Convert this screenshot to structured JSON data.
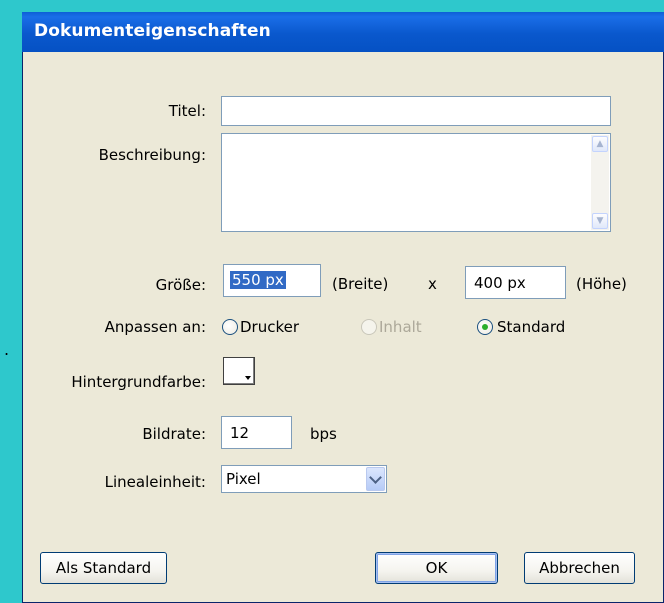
{
  "background_color": "#2ec8cc",
  "stray_text": ".",
  "dialog": {
    "title": "Dokumenteigenschaften",
    "titlebar_color": "#0a58cd",
    "titel": {
      "label": "Titel:",
      "value": ""
    },
    "beschreibung": {
      "label": "Beschreibung:",
      "value": ""
    },
    "groesse": {
      "label": "Größe:",
      "width_value": "550 px",
      "width_suffix": "(Breite)",
      "times": "x",
      "height_value": "400 px",
      "height_suffix": "(Höhe)"
    },
    "anpassen": {
      "label": "Anpassen an:",
      "options": [
        {
          "label": "Drucker",
          "selected": false,
          "enabled": true
        },
        {
          "label": "Inhalt",
          "selected": false,
          "enabled": false
        },
        {
          "label": "Standard",
          "selected": true,
          "enabled": true
        }
      ]
    },
    "hintergrundfarbe": {
      "label": "Hintergrundfarbe:",
      "color": "#ffffff"
    },
    "bildrate": {
      "label": "Bildrate:",
      "value": "12",
      "unit": "bps"
    },
    "linealeinheit": {
      "label": "Linealeinheit:",
      "value": "Pixel"
    },
    "buttons": {
      "als_standard": "Als Standard",
      "ok": "OK",
      "abbrechen": "Abbrechen"
    }
  }
}
